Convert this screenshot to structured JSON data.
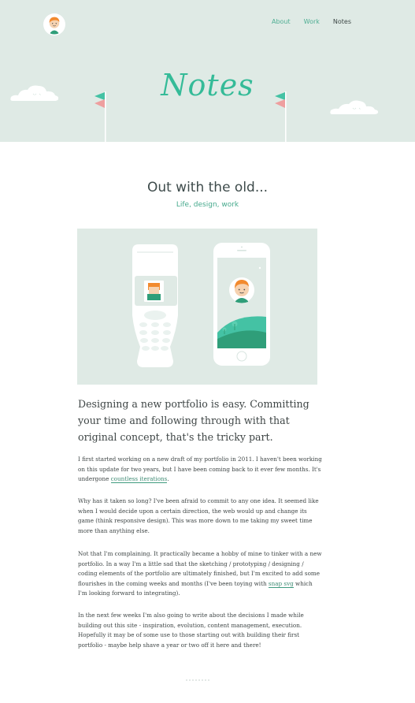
{
  "nav": {
    "items": [
      {
        "label": "About"
      },
      {
        "label": "Work"
      },
      {
        "label": "Notes"
      }
    ]
  },
  "hero": {
    "title": "Notes"
  },
  "post": {
    "title": "Out with the old...",
    "tags": "Life, design, work",
    "lead": "Designing a new portfolio is easy. Committing your time and following through with that original concept, that's the tricky part.",
    "p1_before": "I first started working on a new draft of my portfolio in 2011. I haven't been working on this update for two years, but I have been coming back to it ever few months. It's undergone ",
    "p1_link": "countless iterations",
    "p1_after": ".",
    "p2": "Why has it taken so long? I've been afraid to commit to any one idea. It seemed like when I would decide upon a certain direction, the web would up and change its game (think responsive design). This was more down to me taking my sweet time more than anything else.",
    "p3_before": "Not that I'm complaining. It practically became a hobby of mine to tinker with a new portfolio. In a way I'm a little sad that the sketching / prototyping / designing / coding elements of the portfolio are ultimately finished, but I'm excited to add some flourishes in the coming weeks and months (I've been toying with ",
    "p3_link": "snap svg",
    "p3_after": " which I'm looking forward to integrating).",
    "p4": "In the next few weeks I'm also going to write about the decisions I made while building out this site - inspiration, evolution, content management, execution. Hopefully it may be of some use to those starting out with building their first portfolio - maybe help shave a year or two off it here and there!"
  },
  "colors": {
    "hero_bg": "#dfeae5",
    "accent": "#35bb98",
    "flag_pink": "#ee9f9f",
    "flag_teal": "#44c2a4"
  },
  "icons": [
    "avatar-icon",
    "cloud-icon",
    "flag-icon",
    "nokia-phone-icon",
    "iphone-icon"
  ]
}
